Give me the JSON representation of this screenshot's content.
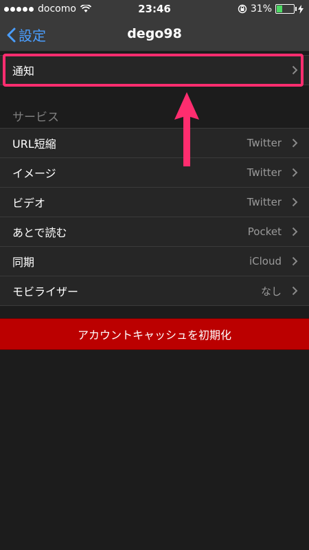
{
  "status_bar": {
    "carrier": "docomo",
    "time": "23:46",
    "battery": "31%",
    "battery_level": 0.31
  },
  "nav": {
    "back_label": "設定",
    "title": "dego98"
  },
  "notification_row": {
    "label": "通知"
  },
  "services": {
    "header": "サービス",
    "items": [
      {
        "label": "URL短縮",
        "value": "Twitter"
      },
      {
        "label": "イメージ",
        "value": "Twitter"
      },
      {
        "label": "ビデオ",
        "value": "Twitter"
      },
      {
        "label": "あとで読む",
        "value": "Pocket"
      },
      {
        "label": "同期",
        "value": "iCloud"
      },
      {
        "label": "モビライザー",
        "value": "なし"
      }
    ]
  },
  "reset_button": {
    "label": "アカウントキャッシュを初期化"
  },
  "colors": {
    "accent": "#4a9eff",
    "highlight": "#ff2d6f",
    "danger": "#bb0000"
  }
}
